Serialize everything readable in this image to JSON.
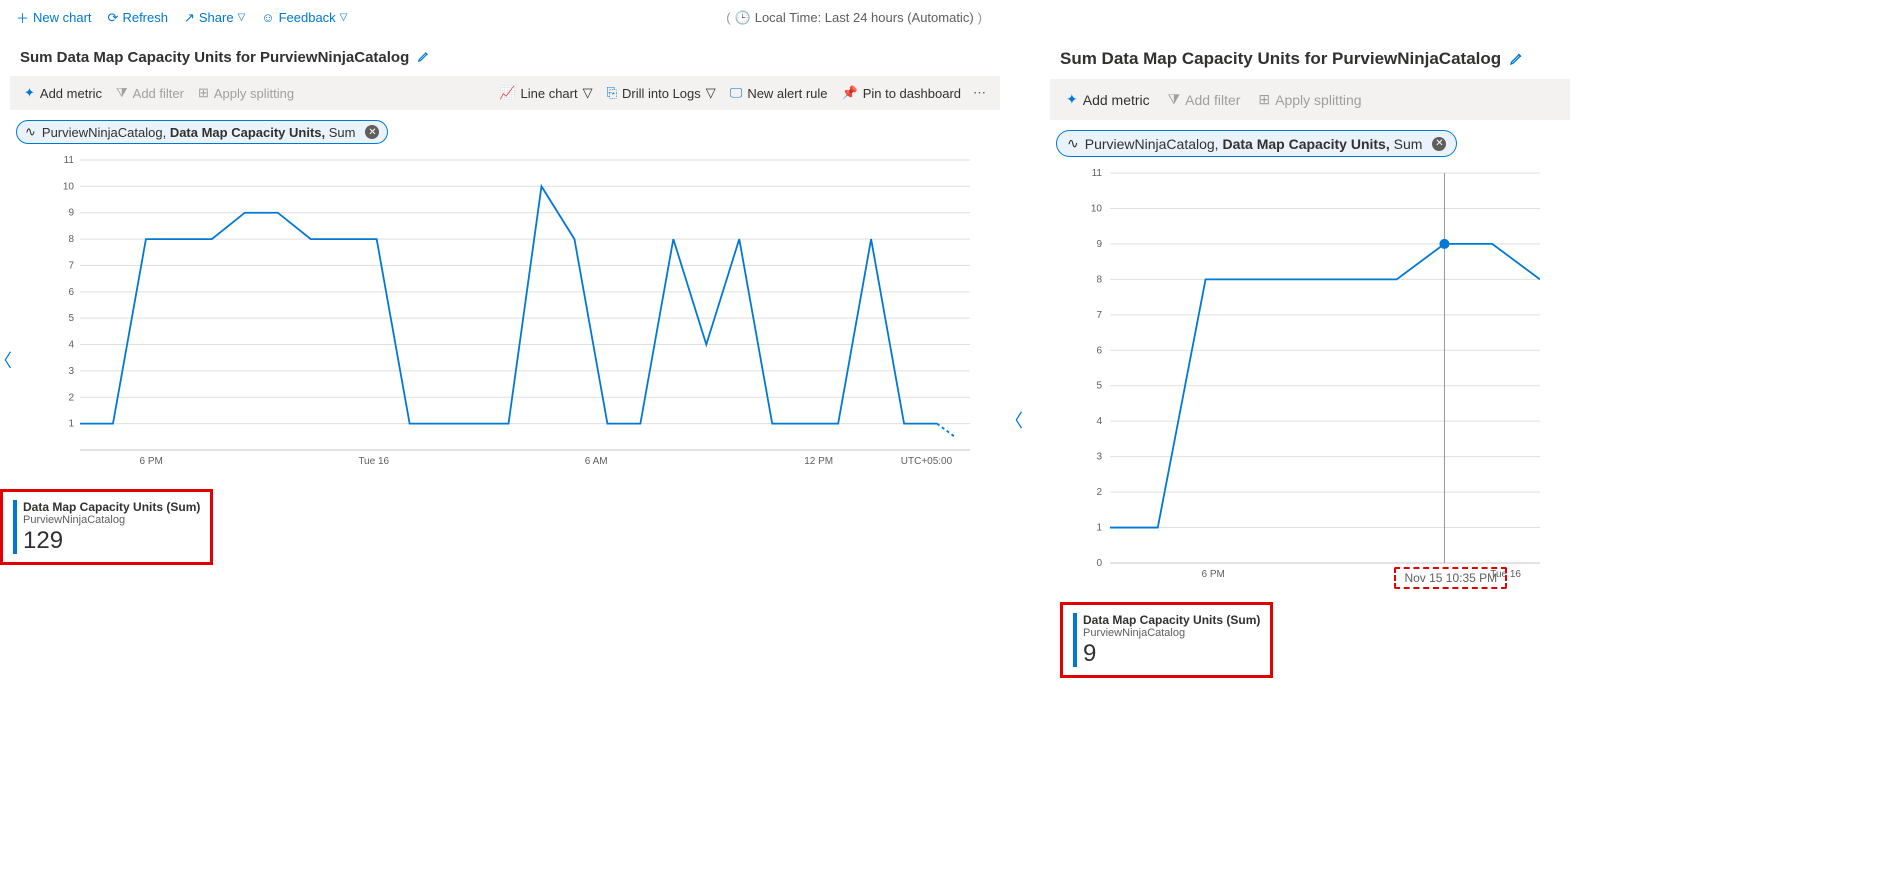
{
  "commands": {
    "new_chart": "New chart",
    "refresh": "Refresh",
    "share": "Share",
    "feedback": "Feedback"
  },
  "time_range_label": "Local Time: Last 24 hours (Automatic)",
  "left_panel": {
    "title": "Sum Data Map Capacity Units for PurviewNinjaCatalog",
    "toolbar": {
      "add_metric": "Add metric",
      "add_filter": "Add filter",
      "apply_splitting": "Apply splitting",
      "line_chart": "Line chart",
      "drill_logs": "Drill into Logs",
      "new_alert": "New alert rule",
      "pin": "Pin to dashboard"
    },
    "pill": {
      "resource": "PurviewNinjaCatalog, ",
      "metric": "Data Map Capacity Units, ",
      "agg": "Sum"
    },
    "legend": {
      "line1": "Data Map Capacity Units (Sum)",
      "line2": "PurviewNinjaCatalog",
      "value": "129"
    },
    "x_ticks": [
      "6 PM",
      "Tue 16",
      "6 AM",
      "12 PM",
      "UTC+05:00"
    ]
  },
  "right_panel": {
    "title": "Sum Data Map Capacity Units for PurviewNinjaCatalog",
    "toolbar": {
      "add_metric": "Add metric",
      "add_filter": "Add filter",
      "apply_splitting": "Apply splitting"
    },
    "pill": {
      "resource": "PurviewNinjaCatalog, ",
      "metric": "Data Map Capacity Units, ",
      "agg": "Sum"
    },
    "legend": {
      "line1": "Data Map Capacity Units (Sum)",
      "line2": "PurviewNinjaCatalog",
      "value": "9"
    },
    "x_ticks": [
      "6 PM",
      "Tue 16"
    ],
    "hover_time": "Nov 15 10:35 PM"
  },
  "chart_data": [
    {
      "type": "line",
      "title": "Sum Data Map Capacity Units for PurviewNinjaCatalog",
      "ylabel": "",
      "xlabel": "",
      "ylim": [
        0,
        11
      ],
      "y_ticks": [
        1,
        2,
        3,
        4,
        5,
        6,
        7,
        8,
        9,
        10,
        11
      ],
      "x_labels": [
        "6 PM",
        "Tue 16",
        "6 AM",
        "12 PM",
        "UTC+05:00"
      ],
      "series": [
        {
          "name": "Data Map Capacity Units (Sum)",
          "values": [
            1,
            1,
            8,
            8,
            8,
            9,
            9,
            8,
            8,
            8,
            1,
            1,
            1,
            1,
            10,
            8,
            1,
            1,
            8,
            4,
            8,
            1,
            1,
            1,
            8,
            1,
            1
          ]
        }
      ],
      "trailing_dashed_value": 0.5,
      "legend_total": 129
    },
    {
      "type": "line",
      "title": "Sum Data Map Capacity Units for PurviewNinjaCatalog",
      "ylabel": "",
      "xlabel": "",
      "ylim": [
        0,
        11
      ],
      "y_ticks": [
        0,
        1,
        2,
        3,
        4,
        5,
        6,
        7,
        8,
        9,
        10,
        11
      ],
      "x_labels": [
        "6 PM",
        "Tue 16"
      ],
      "series": [
        {
          "name": "Data Map Capacity Units (Sum)",
          "values": [
            1,
            1,
            8,
            8,
            8,
            8,
            8,
            9,
            9,
            8
          ]
        }
      ],
      "hover_point": {
        "x_index": 7,
        "value": 9,
        "time": "Nov 15 10:35 PM"
      },
      "legend_hover_value": 9
    }
  ]
}
